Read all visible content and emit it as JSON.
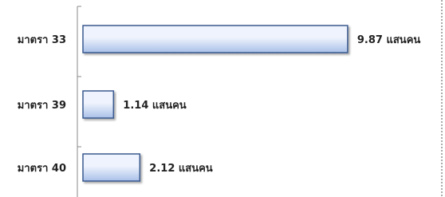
{
  "chart_data": {
    "type": "bar",
    "orientation": "horizontal",
    "categories": [
      "มาตรา 33",
      "มาตรา 39",
      "มาตรา 40"
    ],
    "values": [
      9.87,
      1.14,
      2.12
    ],
    "data_labels": [
      "9.87 แสนคน",
      "1.14 แสนคน",
      "2.12 แสนคน"
    ],
    "unit": "แสนคน",
    "title": "",
    "xlabel": "",
    "ylabel": "",
    "xlim": [
      0,
      10.2
    ],
    "grid": false,
    "legend": "none",
    "colors": {
      "bar_fill_light": "#eef3fd",
      "bar_fill_dark": "#a9c0e8",
      "bar_stroke": "#3b5a8f",
      "axis": "#888888",
      "border": "#555555"
    }
  }
}
